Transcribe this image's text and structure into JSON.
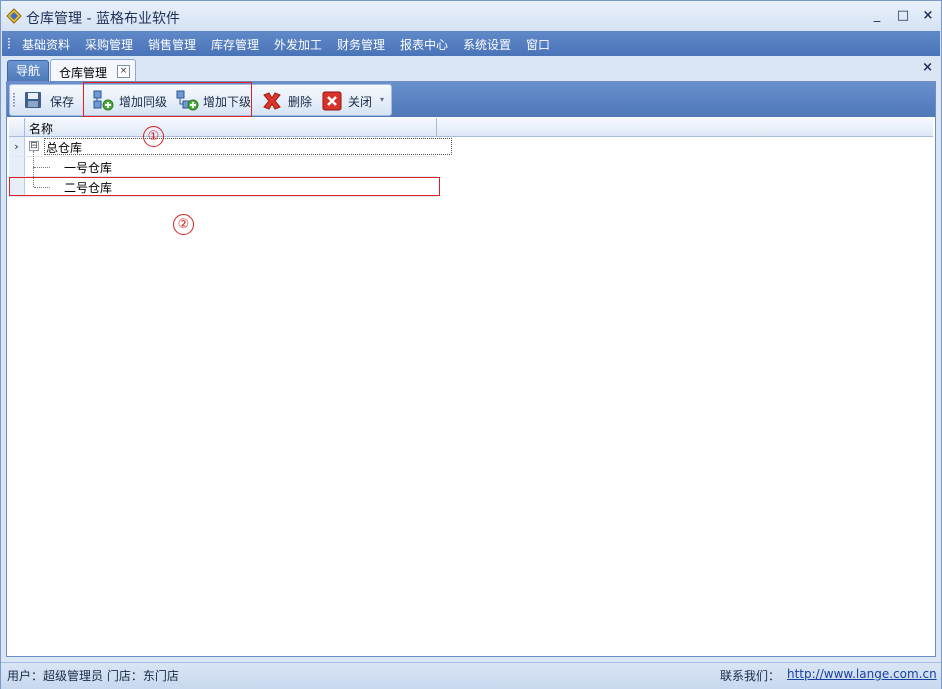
{
  "window": {
    "title": "仓库管理 - 蓝格布业软件",
    "buttons": [
      "_",
      "□",
      "×"
    ]
  },
  "menu": {
    "items": [
      "基础资料",
      "采购管理",
      "销售管理",
      "库存管理",
      "外发加工",
      "财务管理",
      "报表中心",
      "系统设置",
      "窗口"
    ]
  },
  "tabs": {
    "nav_label": "导航",
    "active_label": "仓库管理",
    "tab_close_glyph": "×",
    "panel_close_glyph": "×"
  },
  "toolbar": {
    "save_label": "保存",
    "add_sibling_label": "增加同级",
    "add_child_label": "增加下级",
    "delete_label": "删除",
    "close_label": "关闭",
    "dropdown_glyph": "▾"
  },
  "grid": {
    "column_name": "名称",
    "rows": [
      {
        "label": "总仓库",
        "indicator": "›",
        "expander": "⊟"
      },
      {
        "label": "一号仓库",
        "indicator": ""
      },
      {
        "label": "二号仓库",
        "indicator": ""
      }
    ]
  },
  "annotations": {
    "one": "①",
    "two": "②"
  },
  "status": {
    "user_text": "用户：超级管理员  门店：东门店",
    "contact_label": "联系我们：",
    "link": "http://www.lange.com.cn"
  },
  "colors": {
    "menu_bar": "#4a74b8",
    "annotation_red": "#e02020",
    "delete_red": "#e0352b"
  }
}
